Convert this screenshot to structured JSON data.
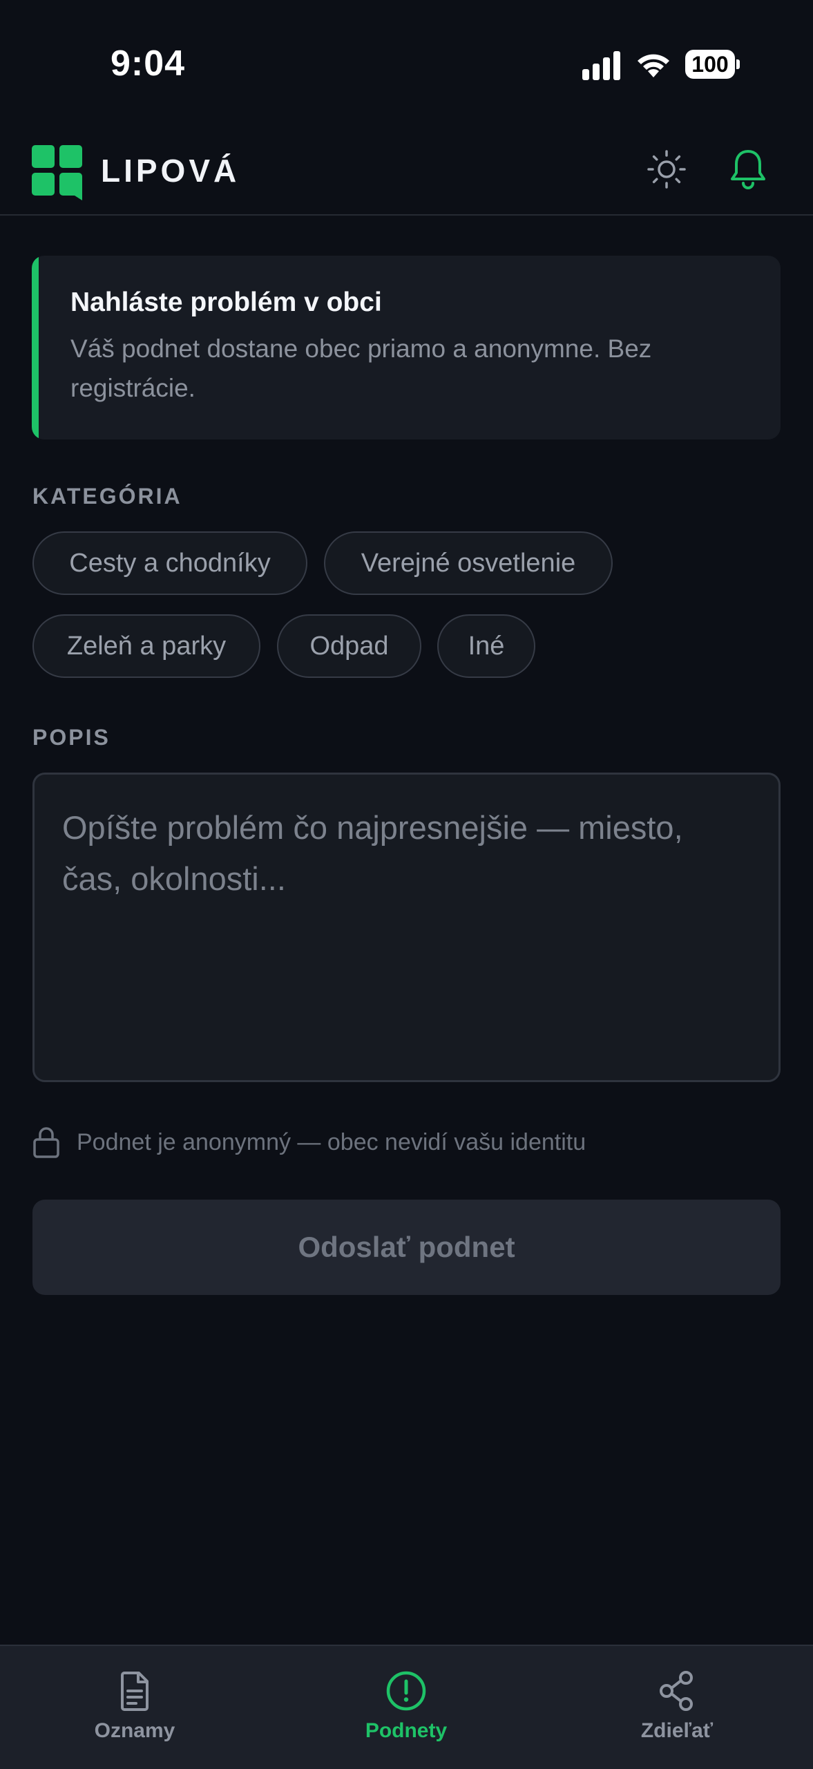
{
  "status_bar": {
    "time": "9:04",
    "battery": "100",
    "icons": [
      "signal-icon",
      "wifi-icon",
      "battery-icon"
    ]
  },
  "header": {
    "app_name": "LIPOVÁ",
    "icons": [
      "logo-icon",
      "sun-icon",
      "bell-icon"
    ]
  },
  "info_card": {
    "title": "Nahláste problém v obci",
    "text": "Váš podnet dostane obec priamo a anonymne. Bez registrácie."
  },
  "category": {
    "label": "KATEGÓRIA",
    "chips": [
      "Cesty a chodníky",
      "Verejné osvetlenie",
      "Zeleň a parky",
      "Odpad",
      "Iné"
    ]
  },
  "description": {
    "label": "POPIS",
    "placeholder": "Opíšte problém čo najpresnejšie — miesto, čas, okolnosti..."
  },
  "anonymity_note": "Podnet je anonymný — obec nevidí vašu identitu",
  "submit_label": "Odoslať podnet",
  "bottom_nav": {
    "items": [
      {
        "label": "Oznamy",
        "icon": "document-icon",
        "active": false
      },
      {
        "label": "Podnety",
        "icon": "alert-circle-icon",
        "active": true
      },
      {
        "label": "Zdieľať",
        "icon": "share-icon",
        "active": false
      }
    ]
  },
  "colors": {
    "accent": "#1ec267",
    "background": "#0c0f16",
    "card": "#171b23"
  }
}
